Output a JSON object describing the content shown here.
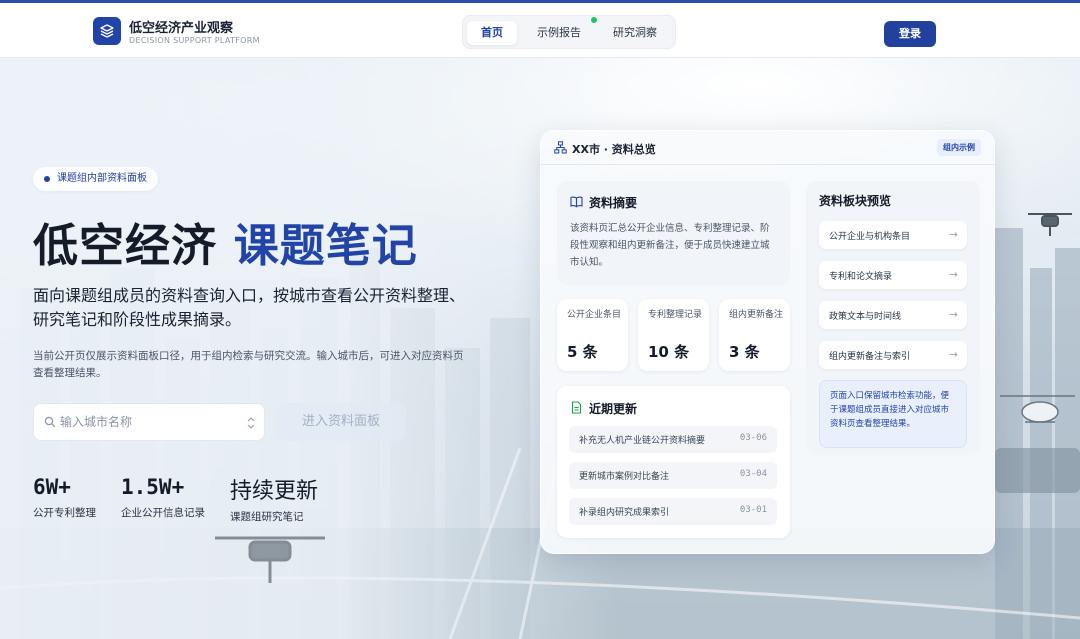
{
  "header": {
    "brand_title": "低空经济产业观察",
    "brand_subtitle": "DECISION SUPPORT PLATFORM",
    "logo_icon": "layers-icon",
    "nav": [
      {
        "label": "首页",
        "active": true
      },
      {
        "label": "示例报告",
        "active": false
      },
      {
        "label": "研究洞察",
        "active": false
      }
    ],
    "login_label": "登录"
  },
  "hero": {
    "pill": "课题组内部资料面板",
    "title_main": "低空经济",
    "title_highlight": "课题笔记",
    "description": "面向课题组成员的资料查询入口，按城市查看公开资料整理、研究笔记和阶段性成果摘录。",
    "note": "当前公开页仅展示资料面板口径，用于组内检索与研究交流。输入城市后，可进入对应资料页查看整理结果。",
    "search_placeholder": "输入城市名称",
    "enter_label": "进入资料面板",
    "stats": [
      {
        "value": "6W+",
        "label": "公开专利整理"
      },
      {
        "value": "1.5W+",
        "label": "企业公开信息记录"
      },
      {
        "value": "持续更新",
        "label": "课题组研究笔记"
      }
    ]
  },
  "card": {
    "title": "XX市 · 资料总览",
    "tag": "组内示例",
    "summary": {
      "title": "资料摘要",
      "text": "该资料页汇总公开企业信息、专利整理记录、阶段性观察和组内更新备注，便于成员快速建立城市认知。"
    },
    "kpis": [
      {
        "label": "公开企业条目",
        "value": "5 条"
      },
      {
        "label": "专利整理记录",
        "value": "10 条"
      },
      {
        "label": "组内更新备注",
        "value": "3 条"
      }
    ],
    "updates": {
      "title": "近期更新",
      "items": [
        {
          "text": "补充无人机产业链公开资料摘要",
          "date": "03-06"
        },
        {
          "text": "更新城市案例对比备注",
          "date": "03-04"
        },
        {
          "text": "补录组内研究成果索引",
          "date": "03-01"
        }
      ]
    },
    "modules": {
      "title": "资料板块预览",
      "items": [
        {
          "label": "公开企业与机构条目"
        },
        {
          "label": "专利和论文摘录"
        },
        {
          "label": "政策文本与时间线"
        },
        {
          "label": "组内更新备注与索引"
        }
      ],
      "note": "页面入口保留城市检索功能，便于课题组成员直接进入对应城市资料页查看整理结果。"
    }
  },
  "colors": {
    "brand": "#2244a8",
    "login": "#22409e",
    "status_dot": "#22c55e"
  }
}
